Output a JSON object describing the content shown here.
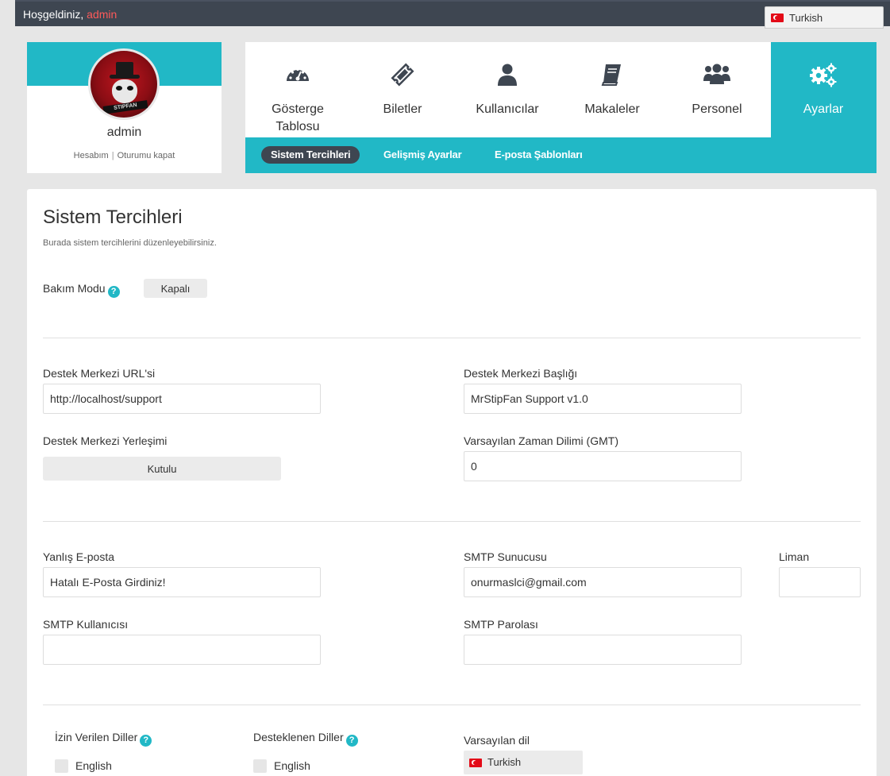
{
  "topbar": {
    "welcome_text": "Hoşgeldiniz, ",
    "user_name": "admin",
    "language_label": "Turkish"
  },
  "profile": {
    "name": "admin",
    "avatar_text": "STIPFAN",
    "account_link": "Hesabım",
    "separator": "|",
    "logout_link": "Oturumu kapat"
  },
  "nav": {
    "items": [
      {
        "label": "Gösterge Tablosu",
        "icon": "dashboard-icon"
      },
      {
        "label": "Biletler",
        "icon": "ticket-icon"
      },
      {
        "label": "Kullanıcılar",
        "icon": "user-icon"
      },
      {
        "label": "Makaleler",
        "icon": "book-icon"
      },
      {
        "label": "Personel",
        "icon": "users-icon"
      },
      {
        "label": "Ayarlar",
        "icon": "gears-icon",
        "active": true
      }
    ],
    "subitems": [
      {
        "label": "Sistem Tercihleri",
        "active": true
      },
      {
        "label": "Gelişmiş Ayarlar"
      },
      {
        "label": "E-posta Şablonları"
      }
    ]
  },
  "page": {
    "title": "Sistem Tercihleri",
    "subtitle": "Burada sistem tercihlerini düzenleyebilirsiniz.",
    "maintenance": {
      "label": "Bakım Modu",
      "value": "Kapalı"
    },
    "help_glyph": "?",
    "fields": {
      "url_label": "Destek Merkezi URL'si",
      "url_value": "http://localhost/support",
      "title_label": "Destek Merkezi Başlığı",
      "title_value": "MrStipFan Support v1.0",
      "layout_label": "Destek Merkezi Yerleşimi",
      "layout_value": "Kutulu",
      "timezone_label": "Varsayılan Zaman Dilimi (GMT)",
      "timezone_value": "0",
      "wrong_email_label": "Yanlış E-posta",
      "wrong_email_value": "Hatalı E-Posta Girdiniz!",
      "smtp_server_label": "SMTP Sunucusu",
      "smtp_server_value": "onurmaslci@gmail.com",
      "port_label": "Liman",
      "port_value": "",
      "smtp_user_label": "SMTP Kullanıcısı",
      "smtp_user_value": "",
      "smtp_pass_label": "SMTP Parolası",
      "smtp_pass_value": ""
    },
    "languages": {
      "allowed_label": "İzin Verilen Diller",
      "allowed_items": [
        "English"
      ],
      "supported_label": "Desteklenen Diller",
      "supported_items": [
        "English"
      ],
      "default_label": "Varsayılan dil",
      "default_value": "Turkish"
    }
  },
  "colors": {
    "accent": "#21b8c6",
    "dark": "#3e4651",
    "user_highlight": "#ff5a5a"
  }
}
